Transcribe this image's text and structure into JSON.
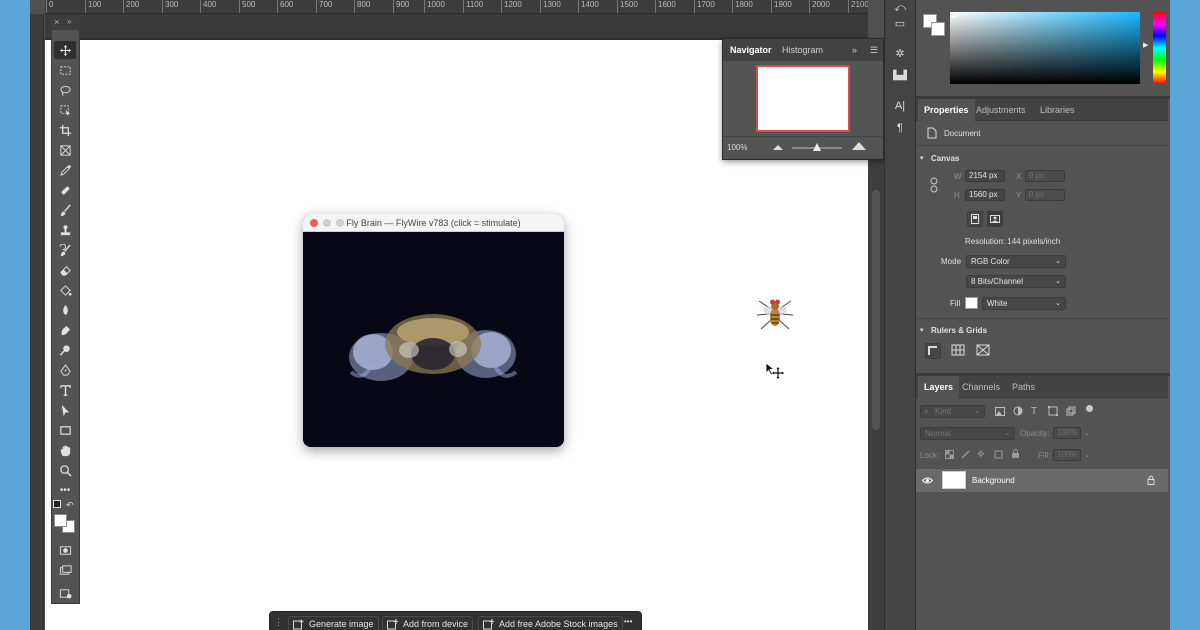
{
  "ruler": {
    "ticks": [
      "0",
      "100",
      "200",
      "300",
      "400",
      "500",
      "600",
      "700",
      "800",
      "900",
      "1000",
      "1100",
      "1200",
      "1300",
      "1400",
      "1500",
      "1600",
      "1700",
      "1800",
      "1900",
      "2000",
      "2100"
    ]
  },
  "fly_window": {
    "title": "Fly Brain — FlyWire v783 (click = stimulate)"
  },
  "navigator": {
    "tabs": [
      "Navigator",
      "Histogram"
    ],
    "zoom": "100%"
  },
  "properties": {
    "tabs": [
      "Properties",
      "Adjustments",
      "Libraries"
    ],
    "doc_label": "Document",
    "canvas_section": "Canvas",
    "w_label": "W",
    "w_value": "2154 px",
    "h_label": "H",
    "h_value": "1560 px",
    "x_label": "X",
    "x_placeholder": "0 px",
    "y_label": "Y",
    "y_placeholder": "0 px",
    "resolution": "Resolution: 144 pixels/inch",
    "mode_label": "Mode",
    "mode_value": "RGB Color",
    "bits_value": "8 Bits/Channel",
    "fill_label": "Fill",
    "fill_value": "White",
    "rulers_section": "Rulers & Grids"
  },
  "layers": {
    "tabs": [
      "Layers",
      "Channels",
      "Paths"
    ],
    "filter_placeholder": "Kind",
    "blend_mode": "Normal",
    "opacity_label": "Opacity:",
    "opacity_value": "100%",
    "lock_label": "Lock:",
    "fill_label": "Fill:",
    "fill_value": "100%",
    "items": [
      {
        "name": "Background",
        "visible": true,
        "locked": true
      }
    ]
  },
  "taskbar": {
    "buttons": [
      "Generate image",
      "Add from device",
      "Add free Adobe Stock images"
    ],
    "more": "•••"
  },
  "colors": {
    "foreground": "#ffffff",
    "background": "#ffffff",
    "nav_border": "#d94a4a"
  }
}
